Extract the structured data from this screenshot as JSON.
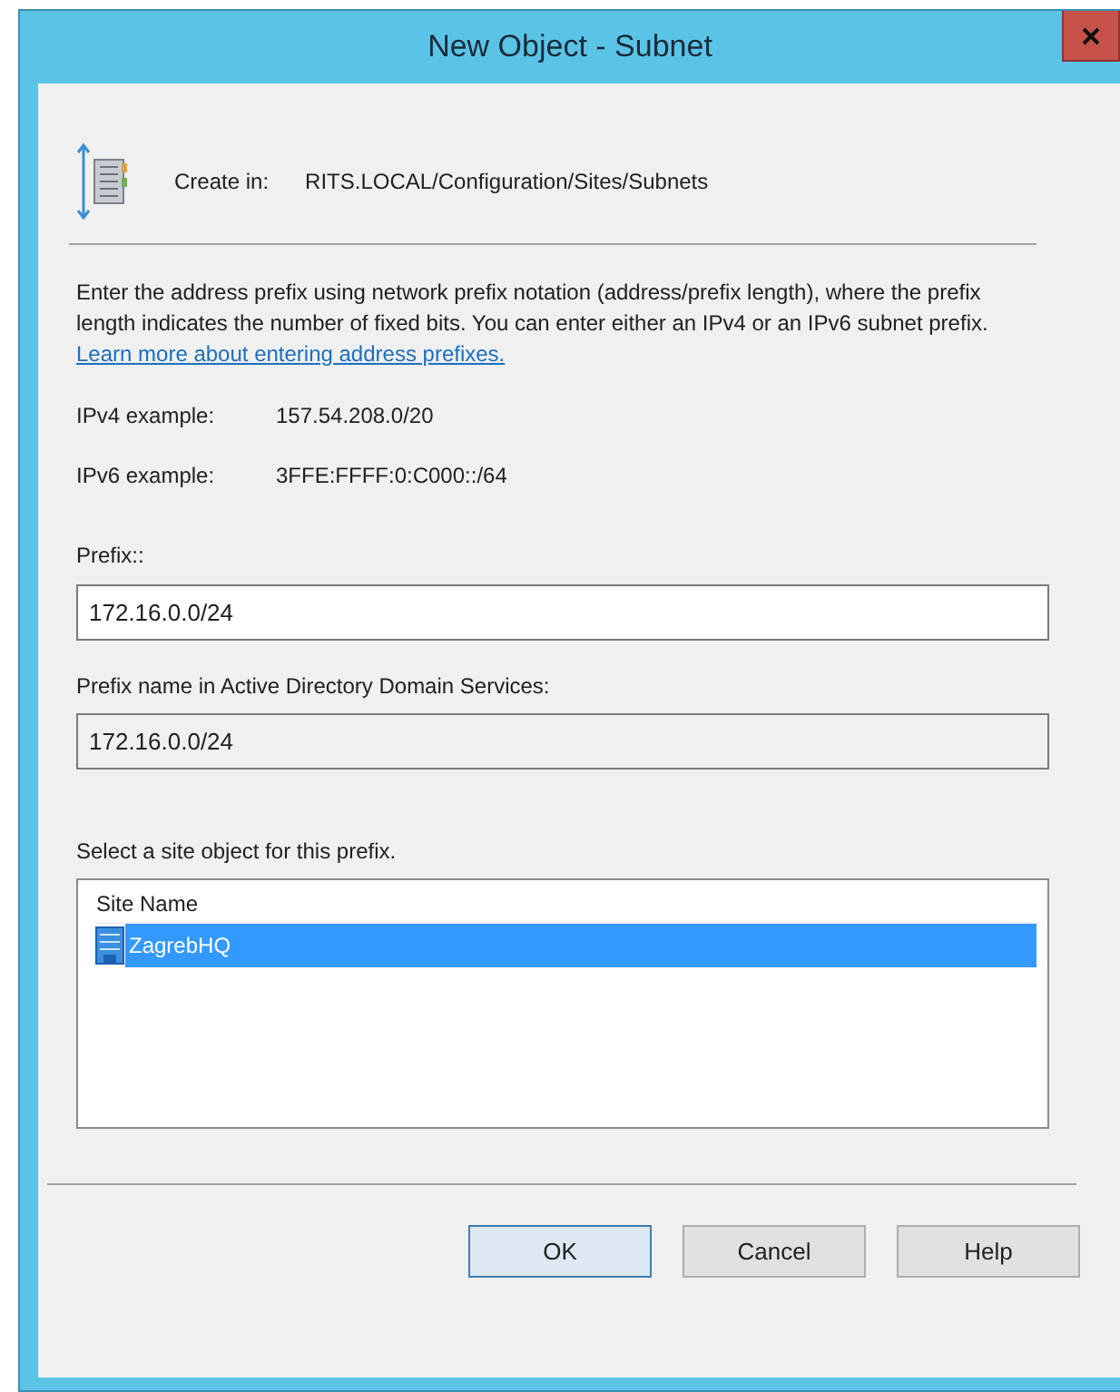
{
  "window": {
    "title": "New Object - Subnet"
  },
  "create_in": {
    "label": "Create in:",
    "path": "RITS.LOCAL/Configuration/Sites/Subnets"
  },
  "description": "Enter the address prefix using network prefix notation (address/prefix length), where the prefix length indicates the number of fixed bits. You can enter either an IPv4 or an IPv6 subnet prefix.",
  "learn_more_link": "Learn more about entering address prefixes.",
  "examples": [
    {
      "label": "IPv4 example:",
      "value": "157.54.208.0/20"
    },
    {
      "label": "IPv6 example:",
      "value": "3FFE:FFFF:0:C000::/64"
    }
  ],
  "prefix": {
    "label": "Prefix::",
    "value": "172.16.0.0/24"
  },
  "prefix_name": {
    "label": "Prefix name in Active Directory Domain Services:",
    "value": "172.16.0.0/24",
    "disabled": true
  },
  "site_list": {
    "label": "Select a site object for this prefix.",
    "column": "Site Name",
    "rows": [
      {
        "name": "ZagrebHQ",
        "selected": true
      }
    ]
  },
  "buttons": [
    {
      "label": "OK",
      "default": true
    },
    {
      "label": "Cancel",
      "default": false
    },
    {
      "label": "Help",
      "default": false
    }
  ]
}
